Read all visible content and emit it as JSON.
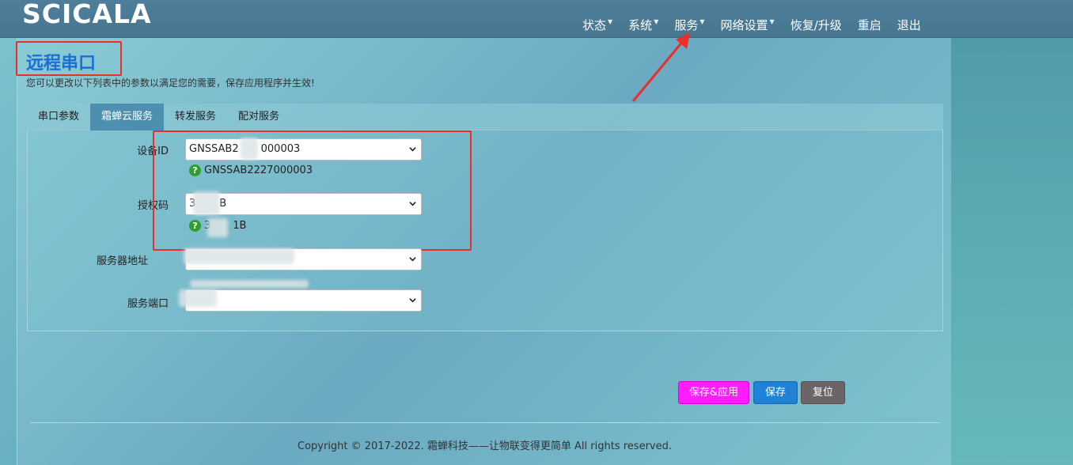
{
  "header": {
    "logo": "SCICALA",
    "nav": [
      {
        "label": "状态",
        "dropdown": true
      },
      {
        "label": "系统",
        "dropdown": true
      },
      {
        "label": "服务",
        "dropdown": true
      },
      {
        "label": "网络设置",
        "dropdown": true
      },
      {
        "label": "恢复/升级",
        "dropdown": false
      },
      {
        "label": "重启",
        "dropdown": false
      },
      {
        "label": "退出",
        "dropdown": false
      }
    ]
  },
  "page": {
    "title": "远程串口",
    "description": "您可以更改以下列表中的参数以满足您的需要，保存应用程序并生效!"
  },
  "tabs": [
    {
      "label": "串口参数",
      "active": false
    },
    {
      "label": "霜蝉云服务",
      "active": true
    },
    {
      "label": "转发服务",
      "active": false
    },
    {
      "label": "配对服务",
      "active": false
    }
  ],
  "form": {
    "device_id": {
      "label": "设备ID",
      "value": "GNSSAB2",
      "value_tail": "000003",
      "hint": "GNSSAB2227000003"
    },
    "auth_code": {
      "label": "授权码",
      "value": "3",
      "value_tail": "B",
      "hint": "3",
      "hint_tail": "1B"
    },
    "server_address": {
      "label": "服务器地址",
      "value": ""
    },
    "server_port": {
      "label": "服务端口",
      "value": ""
    }
  },
  "buttons": {
    "save_apply": "保存&应用",
    "save": "保存",
    "reset": "复位"
  },
  "footer": {
    "copyright": "Copyright © 2017-2022. 霜蝉科技——让物联变得更简单 All rights reserved."
  },
  "colors": {
    "accent_title": "#1a6fd6",
    "annotation_red": "#e8302a",
    "save_apply_button": "#ff1cff",
    "save_button": "#1f82d6",
    "reset_button": "#6d6468",
    "active_tab": "#4c8fae",
    "hint_icon": "#2f9e2f"
  }
}
